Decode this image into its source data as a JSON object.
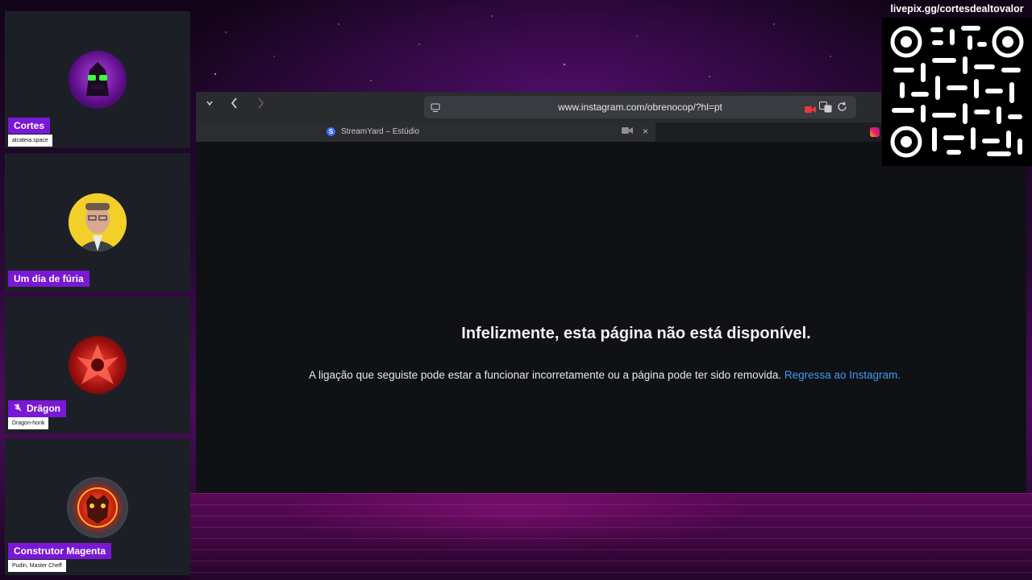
{
  "overlay": {
    "livepix_label": "livepix.gg/cortesdealtovalor"
  },
  "participants": [
    {
      "name": "Cortes",
      "subtitle": "alcateia.space",
      "muted": false
    },
    {
      "name": "Um dia de fúria",
      "subtitle": "",
      "muted": false
    },
    {
      "name": "Drägon",
      "subtitle": "Dragon-honk",
      "muted": true
    },
    {
      "name": "Construtor Magenta",
      "subtitle": "Pudin, Master Cheff",
      "muted": false
    }
  ],
  "browser": {
    "url": "www.instagram.com/obrenocop/?hl=pt",
    "tab_title": "StreamYard – Estúdio"
  },
  "page": {
    "heading": "Infelizmente, esta página não está disponível.",
    "message": "A ligação que seguiste pode estar a funcionar incorretamente ou a página pode ter sido removida.",
    "link_label": "Regressa ao Instagram."
  },
  "icons": {
    "mic_off": "🎙",
    "chevron_down": "⌄",
    "back": "‹",
    "forward": "›",
    "close": "×"
  },
  "colors": {
    "name_tag": "#7a18d6",
    "link": "#3d9df0"
  }
}
